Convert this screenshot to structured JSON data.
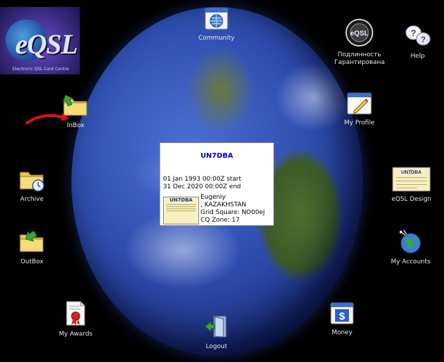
{
  "logo": {
    "text": "eQSL",
    "tagline": "Electronic QSL Card Centre"
  },
  "icons": {
    "community": "Community",
    "authenticity_line1": "Подлинность",
    "authenticity_line2": "Гарантирована",
    "authenticity_badge": "eQSL",
    "help": "Help",
    "inbox": "InBox",
    "my_profile": "My Profile",
    "archive": "Archive",
    "eqsl_design": "eQSL Design",
    "outbox": "OutBox",
    "my_accounts": "My Accounts",
    "my_awards": "My Awards",
    "logout": "Logout",
    "money": "Money",
    "money_symbol": "$"
  },
  "card": {
    "callsign": "UN7DBA",
    "start": "01 Jan 1993 00:00Z start",
    "end": "31 Dec 2020 00:00Z end",
    "name": "Eugeniy",
    "country": ", KAZAKHSTAN",
    "grid": "Grid Square: NO00ej",
    "cq": "CQ Zone: 17",
    "mini_callsign": "UN7DBA"
  },
  "design_thumb_callsign": "UN7DBA",
  "colors": {
    "background": "#000000",
    "callsign": "#0000cc",
    "arrow": "#e0101a"
  }
}
